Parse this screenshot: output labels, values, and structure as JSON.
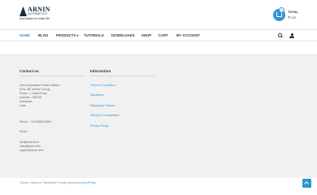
{
  "header": {
    "logo": {
      "name": "ARNIN",
      "sub": "AUTOMATICS",
      "tagline": "Automation for better life"
    },
    "cart": {
      "count": "0",
      "total_label": "TOTAL",
      "total_value": "₹0.00"
    }
  },
  "nav": {
    "items": [
      {
        "label": "HOME",
        "active": true
      },
      {
        "label": "BLOG"
      },
      {
        "label": "PRODUCTS ▾"
      },
      {
        "label": "TUTORIALS"
      },
      {
        "label": "DOWNLOADS"
      },
      {
        "label": "SHOP"
      },
      {
        "label": "CART"
      },
      {
        "label": "MY ACCOUNT"
      }
    ],
    "search_icon": "search-icon",
    "user_icon": "user-icon"
  },
  "footer": {
    "contact": {
      "heading": "Contact us",
      "lines": [
        "Arnin Automatics Private Limited",
        "H.No. 86, Vinihar Colony,",
        "Phase - I, Gokul Road,",
        "Hubballi – 580030",
        "Karnataka",
        "India.",
        "",
        "Phone – +91 8065424690",
        "",
        "Email –",
        "",
        "info@arnin.tech",
        "sales@arnin.tech",
        "support@arnin.tech"
      ]
    },
    "information": {
      "heading": "Information",
      "links": [
        "Terms & Conditions",
        "Disclaimer",
        "Shipping & Returns",
        "Refund & Cancellation",
        "Privacy Policy"
      ]
    }
  },
  "bottom": {
    "credit_prefix": "Theme: eStore by ",
    "credit_theme_author": "ThemeGrill",
    "credit_mid": ". Proudly powered by ",
    "credit_platform": "WordPress"
  },
  "colors": {
    "accent": "#2e95d3",
    "footer_bg": "#f1f1f1"
  }
}
